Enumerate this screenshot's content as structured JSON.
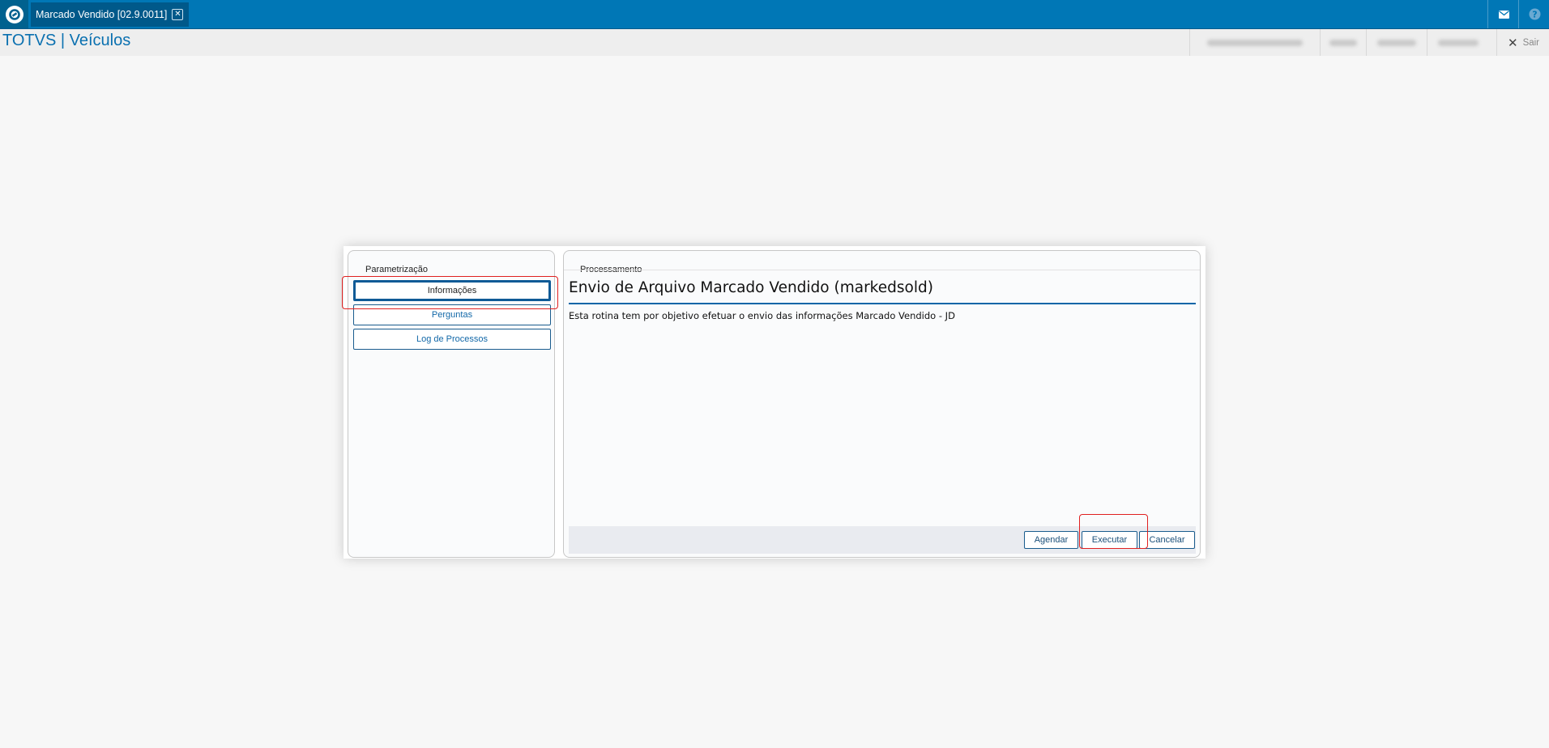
{
  "topbar": {
    "tab_label": "Marcado Vendido [02.9.0011]",
    "icons": [
      "totvs-logo-icon",
      "close-icon",
      "mail-icon",
      "help-icon"
    ]
  },
  "header": {
    "app_title": "TOTVS | Veículos",
    "logout_label": "Sair"
  },
  "dialog": {
    "left_panel": {
      "title": "Parametrização",
      "items": [
        {
          "label": "Informações",
          "active": true
        },
        {
          "label": "Perguntas",
          "active": false
        },
        {
          "label": "Log de Processos",
          "active": false
        }
      ]
    },
    "right_panel": {
      "title": "Processamento",
      "heading": "Envio de Arquivo Marcado Vendido (markedsold)",
      "description": "Esta rotina tem por objetivo efetuar o envio das informações Marcado Vendido - JD",
      "buttons": {
        "schedule": "Agendar",
        "execute": "Executar",
        "cancel": "Cancelar"
      }
    }
  },
  "colors": {
    "brand_blue": "#0077b6",
    "highlight_red": "#e02020"
  }
}
